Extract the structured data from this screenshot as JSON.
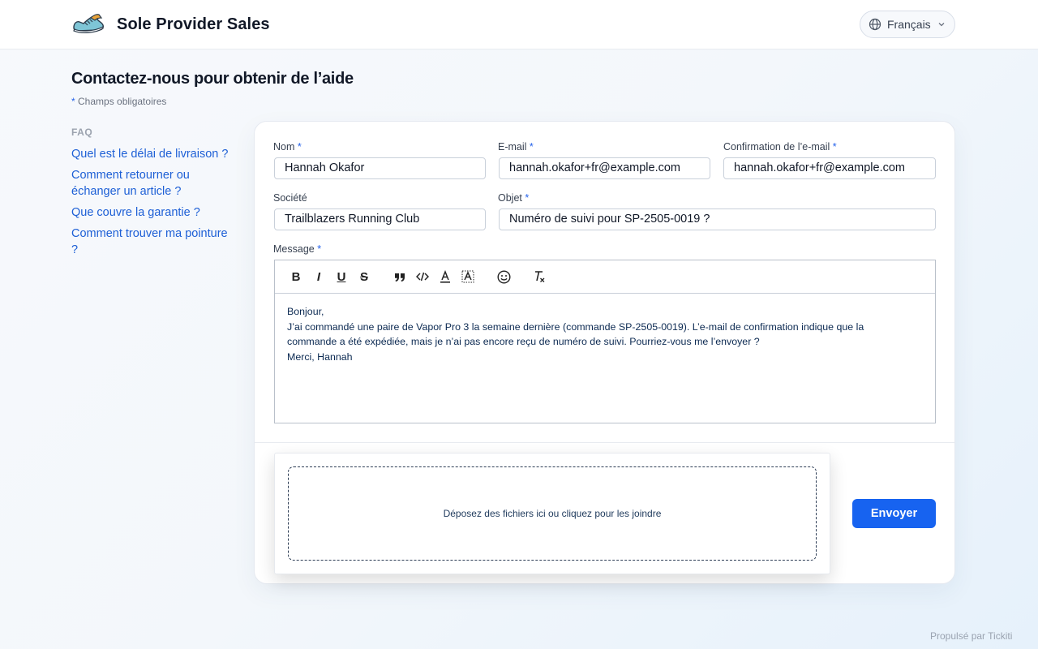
{
  "header": {
    "brand": "Sole Provider Sales",
    "language": "Français"
  },
  "page": {
    "title": "Contactez-nous pour obtenir de l’aide",
    "required_note_star": "*",
    "required_note": "Champs obligatoires"
  },
  "faq": {
    "heading": "FAQ",
    "items": [
      "Quel est le délai de livraison ?",
      "Comment retourner ou échanger un article ?",
      "Que couvre la garantie ?",
      "Comment trouver ma pointure ?"
    ]
  },
  "form": {
    "required_star": "*",
    "name_label": "Nom",
    "name_value": "Hannah Okafor",
    "email_label": "E-mail",
    "email_value": "hannah.okafor+fr@example.com",
    "email_confirm_label": "Confirmation de l’e-mail",
    "email_confirm_value": "hannah.okafor+fr@example.com",
    "company_label": "Société",
    "company_value": "Trailblazers Running Club",
    "subject_label": "Objet",
    "subject_value": "Numéro de suivi pour SP-2505-0019 ?",
    "message_label": "Message",
    "message_lines": [
      "Bonjour,",
      "J’ai commandé une paire de Vapor Pro 3 la semaine dernière (commande SP-2505-0019). L’e-mail de confirmation indique que la",
      "commande a été expédiée, mais je n’ai pas encore reçu de numéro de suivi. Pourriez-vous me l’envoyer ?",
      "Merci, Hannah"
    ],
    "dropzone_text": "Déposez des fichiers ici ou cliquez pour les joindre",
    "submit_label": "Envoyer"
  },
  "toolbar": {
    "bold": "B",
    "italic": "I",
    "underline": "U",
    "strike": "S"
  },
  "footer": {
    "powered_by": "Propulsé par Tickiti"
  },
  "colors": {
    "accent": "#1763f0",
    "link": "#1d5fd6"
  }
}
